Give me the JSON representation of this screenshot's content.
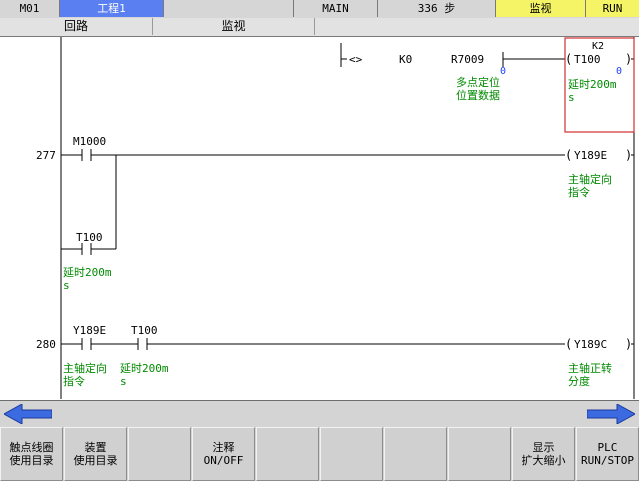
{
  "status_bar": {
    "mode": "M01",
    "project": "工程1",
    "program": "MAIN",
    "steps": "336 步",
    "view_mode": "监视",
    "run_state": "RUN"
  },
  "menu_bar": {
    "circuit": "回路",
    "monitor": "监视"
  },
  "ladder": {
    "rung_top": {
      "compare_op": "<>",
      "operand1": "K0",
      "operand2": "R7009",
      "operand2_value": "0",
      "operand2_comment": [
        "多点定位",
        "位置数据"
      ],
      "coil": "T100",
      "coil_preset": "K2",
      "coil_value": "0",
      "coil_comment": [
        "延时200m",
        "s"
      ]
    },
    "rung_277": {
      "step": "277",
      "contact1": "M1000",
      "contact2": "T100",
      "contact2_comment": [
        "延时200m",
        "s"
      ],
      "coil": "Y189E",
      "coil_comment": [
        "主轴定向",
        "指令"
      ]
    },
    "rung_280": {
      "step": "280",
      "contact1": "Y189E",
      "contact1_comment": [
        "主轴定向",
        "指令"
      ],
      "contact2": "T100",
      "contact2_comment": [
        "延时200m",
        "s"
      ],
      "coil": "Y189C",
      "coil_comment": [
        "主轴正转",
        "分度"
      ]
    }
  },
  "soft_keys": [
    {
      "label": "触点线圈\n使用目录"
    },
    {
      "label": "装置\n使用目录"
    },
    {
      "label": ""
    },
    {
      "label": "注释\nON/OFF"
    },
    {
      "label": ""
    },
    {
      "label": ""
    },
    {
      "label": ""
    },
    {
      "label": ""
    },
    {
      "label": "显示\n扩大缩小"
    },
    {
      "label": "PLC\nRUN/STOP"
    }
  ],
  "colors": {
    "accent_blue": "#5a7ff0",
    "accent_yellow": "#f4f466",
    "comment_green": "#008a00",
    "highlight_red": "#d03030"
  }
}
